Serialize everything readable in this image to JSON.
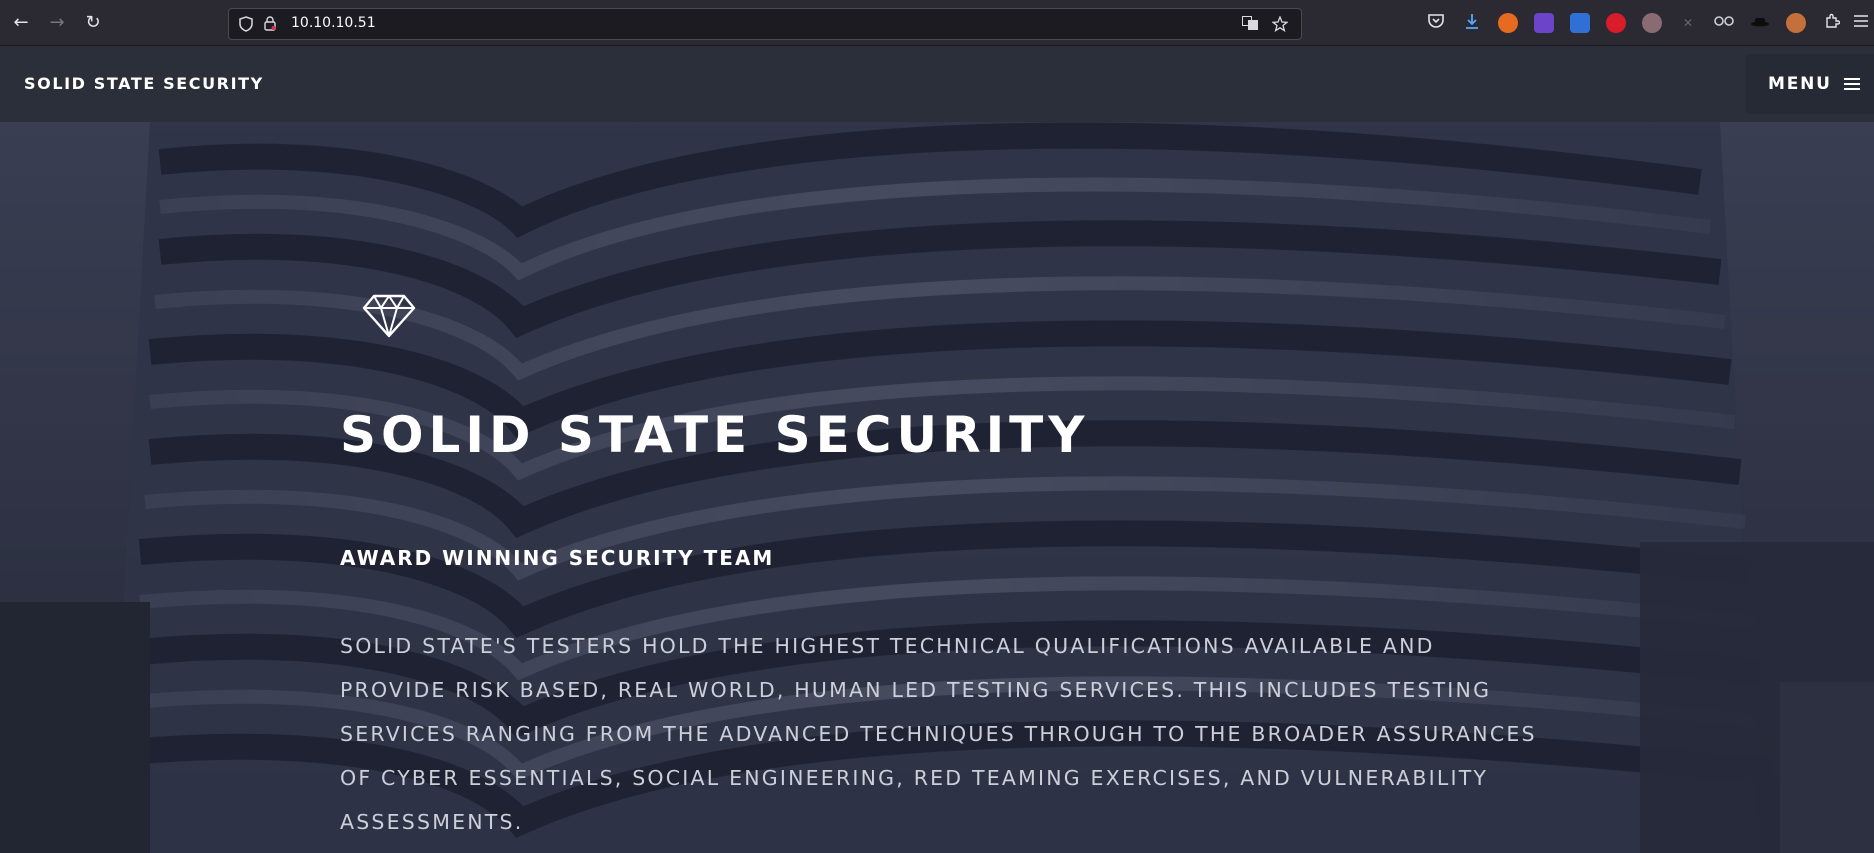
{
  "browser": {
    "url": "10.10.10.51",
    "nav": {
      "back": "←",
      "forward": "→",
      "reload": "↻"
    },
    "icons": [
      "shield-icon",
      "lock-icon",
      "translate-icon",
      "bookmark-star-icon",
      "pocket-icon",
      "download-icon",
      "extensions-icon",
      "menu-icon"
    ]
  },
  "site": {
    "logo": "SOLID STATE SECURITY",
    "menu_label": "MENU"
  },
  "hero": {
    "icon": "diamond-icon",
    "title": "SOLID STATE SECURITY",
    "subtitle": "AWARD WINNING SECURITY TEAM",
    "body": "Solid State's testers hold the highest technical qualifications available and provide risk based, real world, human led testing services. This includes testing services ranging from the advanced techniques through to the broader assurances of Cyber Essentials, Social Engineering, Red Teaming exercises, and Vulnerability Assessments."
  },
  "colors": {
    "chrome_bg": "#2b2a33",
    "header_bg": "#2b2f3a",
    "hero_bg": "#2d3142",
    "text_primary": "#ffffff",
    "text_body": "#ccced8"
  }
}
